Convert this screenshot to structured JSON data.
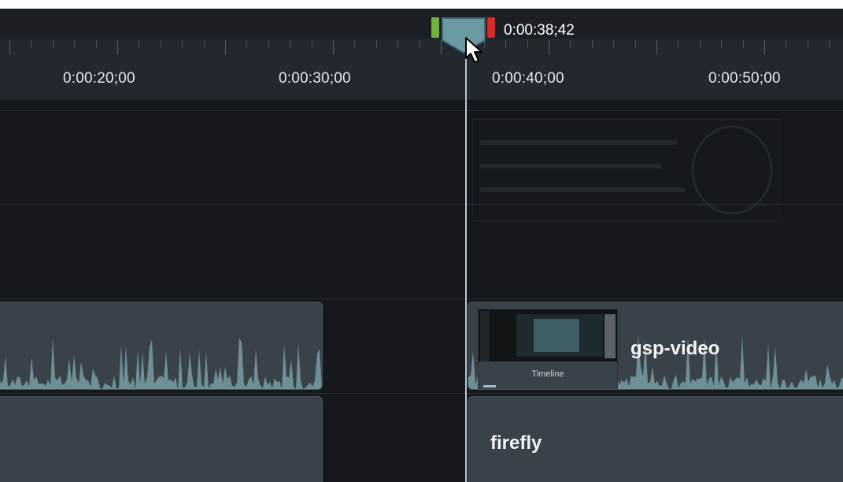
{
  "timeline": {
    "current_time": "0:00:38;42",
    "ruler_labels": [
      "0:00:20;00",
      "0:00:30;00",
      "0:00:40;00",
      "0:00:50;00"
    ]
  },
  "clips": {
    "video_clip_name": "gsp-video",
    "audio_clip_name": "firefly",
    "thumbnail_caption": "Timeline"
  },
  "colors": {
    "background": "#15181c",
    "ruler": "#23282e",
    "clip": "#3a4249",
    "waveform": "#6e8f96",
    "in_marker": "#6fb23c",
    "out_marker": "#d82a2a",
    "playhead": "#b9c6cf"
  },
  "icons": {
    "cursor": "mouse-pointer-icon"
  }
}
